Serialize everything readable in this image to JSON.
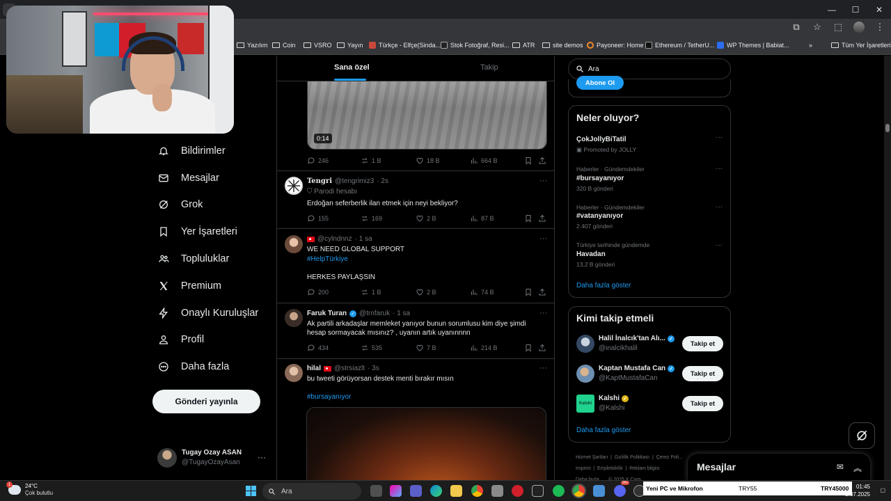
{
  "browser": {
    "window_controls": [
      "—",
      "☐",
      "✕"
    ],
    "bookmarks": [
      {
        "label": "Yazılım",
        "type": "folder"
      },
      {
        "label": "Coin",
        "type": "folder"
      },
      {
        "label": "VSRO",
        "type": "folder"
      },
      {
        "label": "Yayın",
        "type": "folder"
      },
      {
        "label": "Türkçe - Elfçe(Sinda...",
        "type": "site"
      },
      {
        "label": "Stok Fotoğraf, Resi...",
        "type": "site"
      },
      {
        "label": "ATR",
        "type": "folder"
      },
      {
        "label": "site demos",
        "type": "folder"
      },
      {
        "label": "Payoneer: Home",
        "type": "site"
      },
      {
        "label": "Ethereum / TetherU...",
        "type": "site"
      },
      {
        "label": "WP Themes | Babiat...",
        "type": "site"
      }
    ],
    "bookmarks_overflow": "»",
    "all_bookmarks": "Tüm Yer İşaretleri"
  },
  "nav": {
    "items": [
      {
        "label": "Bildirimler",
        "icon": "bell-icon"
      },
      {
        "label": "Mesajlar",
        "icon": "envelope-icon"
      },
      {
        "label": "Grok",
        "icon": "grok-icon"
      },
      {
        "label": "Yer İşaretleri",
        "icon": "bookmark-icon"
      },
      {
        "label": "Topluluklar",
        "icon": "communities-icon"
      },
      {
        "label": "Premium",
        "icon": "x-logo-icon"
      },
      {
        "label": "Onaylı Kuruluşlar",
        "icon": "lightning-icon"
      },
      {
        "label": "Profil",
        "icon": "person-icon"
      },
      {
        "label": "Daha fazla",
        "icon": "more-circle-icon"
      }
    ],
    "post_button": "Gönderi yayınla",
    "account": {
      "name": "Tugay Ozay ASAN",
      "handle": "@TugayOzayAsan",
      "more": "···"
    }
  },
  "feed": {
    "tabs": [
      "Sana özel",
      "Takip"
    ],
    "active_tab": "Sana özel",
    "top_media_duration": "0:14",
    "top_actions": {
      "replies": "246",
      "reposts": "1 B",
      "likes": "18 B",
      "views": "664 B"
    },
    "tweets": [
      {
        "name": "Tengri",
        "handle": "@tengrimiz3",
        "time": "· 2s",
        "label": "Parodi hesabı",
        "text": "Erdoğan seferberlik ilan etmek için neyi bekliyor?",
        "replies": "155",
        "reposts": "169",
        "likes": "2 B",
        "views": "87 B"
      },
      {
        "name": "",
        "handle": "@cylndnnz",
        "time": "· 1 sa",
        "text": "WE NEED GLOBAL SUPPORT",
        "hashtag": "#HelpTürkiye",
        "text2": "HERKES PAYLAŞSIN",
        "replies": "200",
        "reposts": "1 B",
        "likes": "2 B",
        "views": "74 B"
      },
      {
        "name": "Faruk Turan",
        "handle": "@trnfaruk",
        "time": "· 1 sa",
        "text": "Ak partili arkadaşlar memleket yanıyor bunun sorumlusu kim diye şimdi\nhesap sormayacak mısınız? , uyanın artık uyanınnnn",
        "replies": "434",
        "reposts": "535",
        "likes": "7 B",
        "views": "214 B"
      },
      {
        "name": "hilal",
        "handle": "@strsiazlt",
        "time": "· 3s",
        "text": "bu tweeti görüyorsan destek menti bırakır mısın",
        "hashtag": "#bursayanıyor"
      }
    ]
  },
  "right": {
    "search_placeholder": "Ara",
    "subscribe_button": "Abone Ol",
    "trends_title": "Neler oluyor?",
    "trends": [
      {
        "meta": "",
        "name": "ÇokJollyBiTatil",
        "count": "Promoted by JOLLY"
      },
      {
        "meta": "Haberler · Gündemdekiler",
        "name": "#bursayanıyor",
        "count": "320 B gönderi"
      },
      {
        "meta": "Haberler · Gündemdekiler",
        "name": "#vatanyanıyor",
        "count": "2.407 gönderi"
      },
      {
        "meta": "Türkiye tarihinde gündemde",
        "name": "Havadan",
        "count": "13,2 B gönderi"
      }
    ],
    "trends_more": "Daha fazla göster",
    "who_to_follow_title": "Kimi takip etmeli",
    "who_to_follow": [
      {
        "name": "Halil İnalcık'tan Alı...",
        "handle": "@inalcikhalil",
        "button": "Takip et",
        "badge": "blue"
      },
      {
        "name": "Kaptan Mustafa Can",
        "handle": "@KaptMustafaCan",
        "button": "Takip et",
        "badge": "blue"
      },
      {
        "name": "Kalshi",
        "handle": "@Kalshi",
        "button": "Takip et",
        "badge": "gold",
        "avatar_text": "Kalshi"
      }
    ],
    "wtf_more": "Daha fazla göster",
    "footer": [
      "Hizmet Şartları",
      "Gizlilik Politikası",
      "Çerez Poli...",
      "Imprint",
      "Erişilebilirlik",
      "Reklam bilgisi",
      "Daha fazla ...",
      "© 2025 X Corp."
    ],
    "messages_drawer": "Mesajlar"
  },
  "taskbar": {
    "weather_temp": "24°C",
    "weather_desc": "Çok bulutlu",
    "weather_badge": "1",
    "search": "Ara",
    "ticker": [
      "Yeni PC ve Mikrofon",
      "TRY55",
      "TRY45000"
    ],
    "time": "01:45",
    "date": "2.07.2025",
    "notif_badge": "99+"
  },
  "colors": {
    "accent": "#1d9bf0",
    "background": "#000000",
    "border": "#2f3336",
    "muted": "#71767b"
  }
}
